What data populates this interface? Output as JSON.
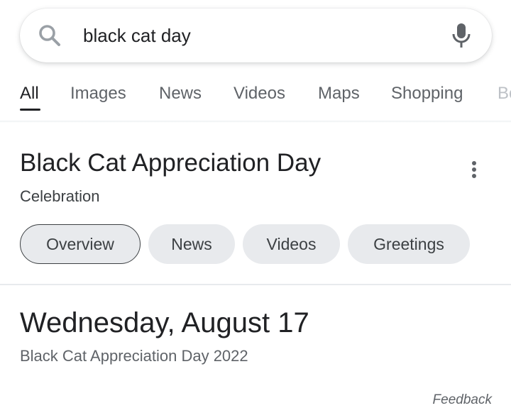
{
  "search": {
    "query": "black cat day",
    "search_icon": "search-icon",
    "mic_icon": "microphone-icon"
  },
  "tabs": [
    {
      "label": "All",
      "active": true
    },
    {
      "label": "Images",
      "active": false
    },
    {
      "label": "News",
      "active": false
    },
    {
      "label": "Videos",
      "active": false
    },
    {
      "label": "Maps",
      "active": false
    },
    {
      "label": "Shopping",
      "active": false
    },
    {
      "label": "Bo",
      "active": false
    }
  ],
  "knowledge_panel": {
    "title": "Black Cat Appreciation Day",
    "subtitle": "Celebration",
    "more_icon": "more-vert-icon",
    "chips": [
      {
        "label": "Overview",
        "selected": true
      },
      {
        "label": "News",
        "selected": false
      },
      {
        "label": "Videos",
        "selected": false
      },
      {
        "label": "Greetings",
        "selected": false
      }
    ]
  },
  "answer": {
    "date": "Wednesday, August 17",
    "description": "Black Cat Appreciation Day 2022"
  },
  "feedback_label": "Feedback",
  "colors": {
    "text_primary": "#202124",
    "text_secondary": "#5f6368",
    "chip_bg": "#e8eaed"
  }
}
